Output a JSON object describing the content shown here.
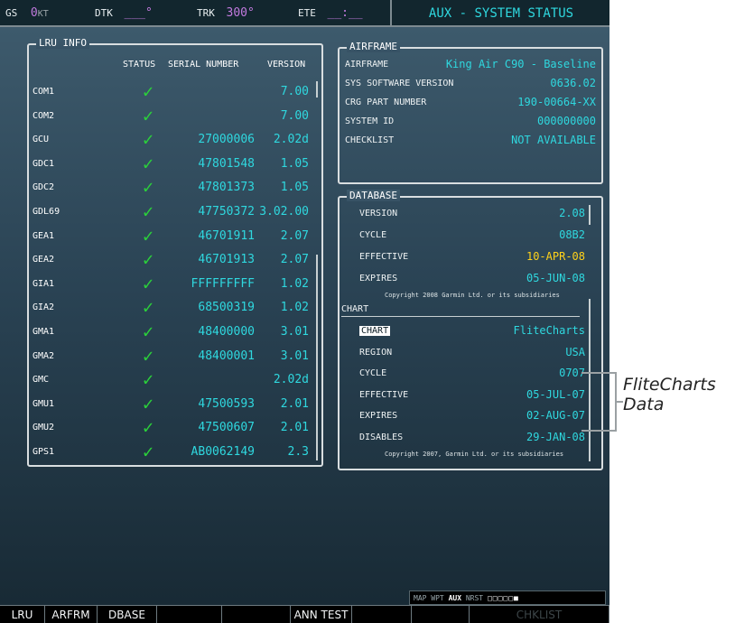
{
  "topbar": {
    "gs_label": "GS",
    "gs_value": "0",
    "gs_unit": "KT",
    "dtk_label": "DTK",
    "dtk_value": "___°",
    "trk_label": "TRK",
    "trk_value": "300°",
    "ete_label": "ETE",
    "ete_value": "__:__",
    "page_title": "AUX - SYSTEM STATUS"
  },
  "lru": {
    "title": "LRU INFO",
    "headers": {
      "status": "STATUS",
      "serial": "SERIAL NUMBER",
      "version": "VERSION"
    },
    "status_icon": "checkmark-icon",
    "check_glyph": "✓",
    "rows": [
      {
        "name": "COM1",
        "serial": "",
        "version": "7.00"
      },
      {
        "name": "COM2",
        "serial": "",
        "version": "7.00"
      },
      {
        "name": "GCU",
        "serial": "27000006",
        "version": "2.02d"
      },
      {
        "name": "GDC1",
        "serial": "47801548",
        "version": "1.05"
      },
      {
        "name": "GDC2",
        "serial": "47801373",
        "version": "1.05"
      },
      {
        "name": "GDL69",
        "serial": "47750372",
        "version": "3.02.00"
      },
      {
        "name": "GEA1",
        "serial": "46701911",
        "version": "2.07"
      },
      {
        "name": "GEA2",
        "serial": "46701913",
        "version": "2.07"
      },
      {
        "name": "GIA1",
        "serial": "FFFFFFFFF",
        "version": "1.02"
      },
      {
        "name": "GIA2",
        "serial": "68500319",
        "version": "1.02"
      },
      {
        "name": "GMA1",
        "serial": "48400000",
        "version": "3.01"
      },
      {
        "name": "GMA2",
        "serial": "48400001",
        "version": "3.01"
      },
      {
        "name": "GMC",
        "serial": "",
        "version": "2.02d"
      },
      {
        "name": "GMU1",
        "serial": "47500593",
        "version": "2.01"
      },
      {
        "name": "GMU2",
        "serial": "47500607",
        "version": "2.01"
      },
      {
        "name": "GPS1",
        "serial": "AB0062149",
        "version": "2.3"
      }
    ]
  },
  "airframe": {
    "title": "AIRFRAME",
    "rows": [
      {
        "label": "AIRFRAME",
        "value": "King Air C90 - Baseline"
      },
      {
        "label": "SYS SOFTWARE VERSION",
        "value": "0636.02"
      },
      {
        "label": "CRG PART NUMBER",
        "value": "190-00664-XX"
      },
      {
        "label": "SYSTEM ID",
        "value": "000000000"
      },
      {
        "label": "CHECKLIST",
        "value": "NOT AVAILABLE"
      }
    ]
  },
  "database": {
    "title": "DATABASE",
    "rows": [
      {
        "label": "VERSION",
        "value": "2.08",
        "color": "#2fd8df"
      },
      {
        "label": "CYCLE",
        "value": "08B2",
        "color": "#2fd8df"
      },
      {
        "label": "EFFECTIVE",
        "value": "10-APR-08",
        "color": "#ffd21a"
      },
      {
        "label": "EXPIRES",
        "value": "05-JUN-08",
        "color": "#2fd8df"
      }
    ],
    "copyright1": "Copyright 2008 Garmin Ltd. or its subsidiaries",
    "chart_heading": "CHART",
    "chart_rows": [
      {
        "label": "CHART",
        "value": "FliteCharts"
      },
      {
        "label": "REGION",
        "value": "USA"
      },
      {
        "label": "CYCLE",
        "value": "0707"
      },
      {
        "label": "EFFECTIVE",
        "value": "05-JUL-07"
      },
      {
        "label": "EXPIRES",
        "value": "02-AUG-07"
      },
      {
        "label": "DISABLES",
        "value": "29-JAN-08"
      }
    ],
    "copyright2": "Copyright 2007, Garmin Ltd. or its subsidiaries"
  },
  "status_strip": {
    "items": [
      "MAP",
      "WPT",
      "AUX",
      "NRST"
    ],
    "active": "AUX",
    "pages": "□□□□□■"
  },
  "softkeys": [
    "LRU",
    "ARFRM",
    "DBASE",
    "",
    "",
    "ANN TEST",
    "",
    "",
    "CHKLIST"
  ],
  "callout": {
    "line1": "FliteCharts",
    "line2": "Data"
  },
  "colors": {
    "cyan": "#2fd8df",
    "yellow": "#ffd21a",
    "check": "#2bd23a",
    "magenta": "#c27adf"
  }
}
